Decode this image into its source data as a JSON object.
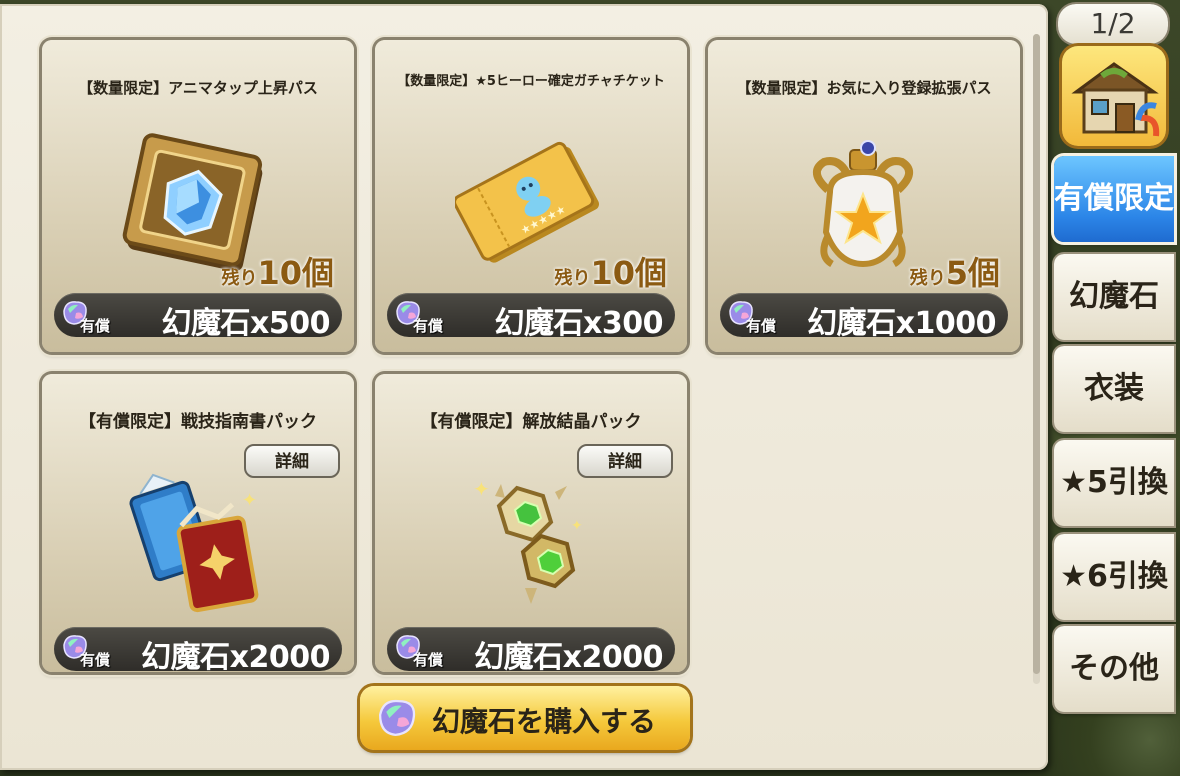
{
  "colors": {
    "accent": "#2c86e8",
    "price_bar": "#3a3833",
    "remain": "#8b5a12",
    "buy_button": "#f5c93c"
  },
  "page_indicator": "1/2",
  "cards": [
    {
      "title": "【数量限定】アニマタップ上昇パス",
      "remain_label": "残り",
      "remain_value": "10個",
      "paid_label": "有償",
      "price": "幻魔石x500",
      "icon": "crystal-plate-icon"
    },
    {
      "title": "【数量限定】★5ヒーロー確定ガチャチケット",
      "remain_label": "残り",
      "remain_value": "10個",
      "paid_label": "有償",
      "price": "幻魔石x300",
      "icon": "gacha-ticket-icon"
    },
    {
      "title": "【数量限定】お気に入り登録拡張パス",
      "remain_label": "残り",
      "remain_value": "5個",
      "paid_label": "有償",
      "price": "幻魔石x1000",
      "icon": "star-bottle-icon"
    },
    {
      "title": "【有償限定】戦技指南書パック",
      "detail": "詳細",
      "paid_label": "有償",
      "price": "幻魔石x2000",
      "icon": "skill-books-icon"
    },
    {
      "title": "【有償限定】解放結晶パック",
      "detail": "詳細",
      "paid_label": "有償",
      "price": "幻魔石x2000",
      "icon": "release-crystal-icon"
    }
  ],
  "buy_button": {
    "label": "幻魔石を購入する"
  },
  "tabs": [
    {
      "label": "有償限定",
      "active": true
    },
    {
      "label": "幻魔石"
    },
    {
      "label": "衣装"
    },
    {
      "label": "★5引換"
    },
    {
      "label": "★6引換"
    },
    {
      "label": "その他"
    }
  ]
}
